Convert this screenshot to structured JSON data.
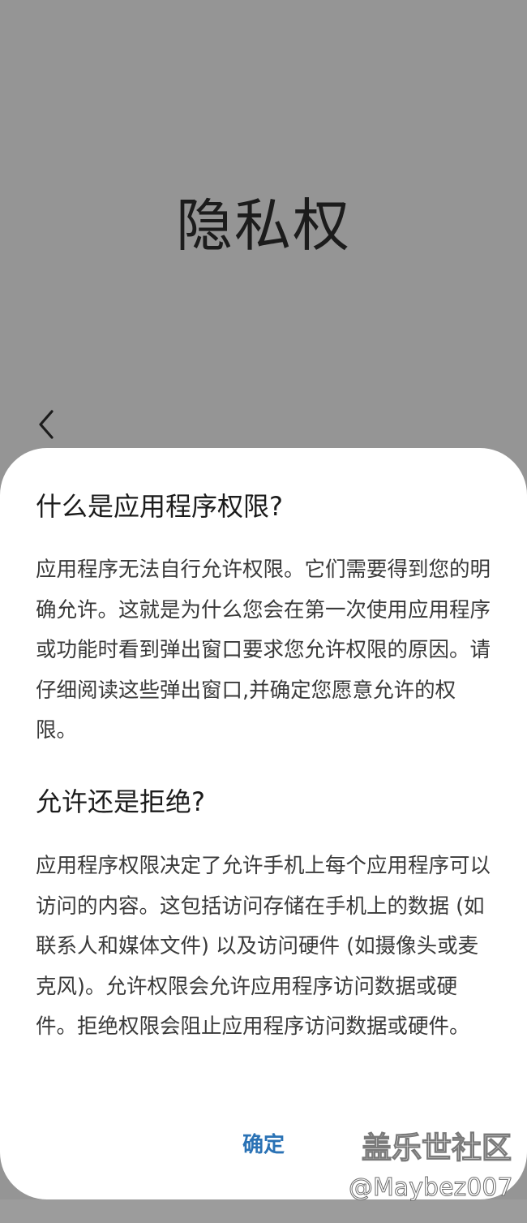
{
  "header": {
    "title": "隐私权",
    "back_icon": "chevron-left-icon"
  },
  "dialog": {
    "sections": [
      {
        "heading": "什么是应用程序权限?",
        "body": "应用程序无法自行允许权限。它们需要得到您的明确允许。这就是为什么您会在第一次使用应用程序或功能时看到弹出窗口要求您允许权限的原因。请仔细阅读这些弹出窗口,并确定您愿意允许的权限。"
      },
      {
        "heading": "允许还是拒绝?",
        "body": "应用程序权限决定了允许手机上每个应用程序可以访问的内容。这包括访问存储在手机上的数据 (如联系人和媒体文件) 以及访问硬件 (如摄像头或麦克风)。允许权限会允许应用程序访问数据或硬件。拒绝权限会阻止应用程序访问数据或硬件。"
      }
    ],
    "confirm_label": "确定"
  },
  "watermark": {
    "name": "盖乐世社区",
    "user": "@Maybez007"
  },
  "colors": {
    "background": "#959595",
    "sheet": "#ffffff",
    "accent": "#2a72b5"
  }
}
